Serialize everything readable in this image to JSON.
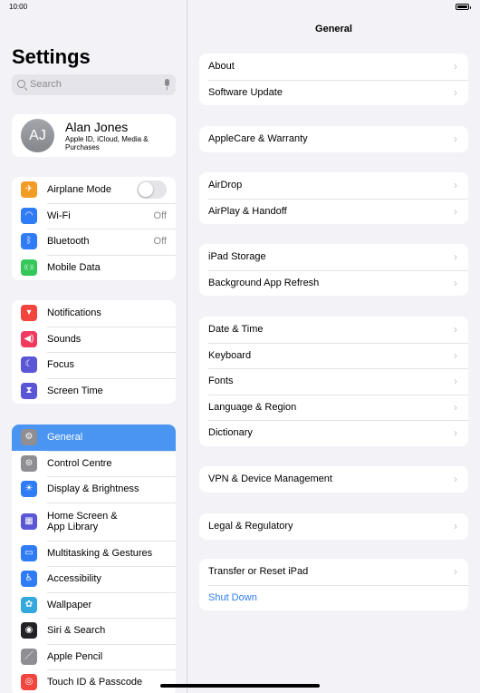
{
  "status": {
    "time": "10:00"
  },
  "sidebar": {
    "title": "Settings",
    "search_placeholder": "Search",
    "profile": {
      "initials": "AJ",
      "name": "Alan Jones",
      "subtitle": "Apple ID, iCloud, Media & Purchases"
    },
    "group1": [
      {
        "label": "Airplane Mode",
        "icon": "airplane-icon",
        "glyph": "✈",
        "color": "#f39c24",
        "control": "toggle"
      },
      {
        "label": "Wi-Fi",
        "icon": "wifi-icon",
        "glyph": "◠",
        "color": "#2f7cf6",
        "value": "Off"
      },
      {
        "label": "Bluetooth",
        "icon": "bluetooth-icon",
        "glyph": "ᛒ",
        "color": "#2f7cf6",
        "value": "Off"
      },
      {
        "label": "Mobile Data",
        "icon": "antenna-icon",
        "glyph": "((·))",
        "color": "#35c759"
      }
    ],
    "group2": [
      {
        "label": "Notifications",
        "icon": "bell-icon",
        "glyph": "▾",
        "color": "#f2453d"
      },
      {
        "label": "Sounds",
        "icon": "speaker-icon",
        "glyph": "◀)",
        "color": "#f03a5f"
      },
      {
        "label": "Focus",
        "icon": "moon-icon",
        "glyph": "☾",
        "color": "#5b56d6"
      },
      {
        "label": "Screen Time",
        "icon": "hourglass-icon",
        "glyph": "⧗",
        "color": "#5b56d6"
      }
    ],
    "group3": [
      {
        "label": "General",
        "icon": "gear-icon",
        "glyph": "⚙",
        "color": "#8e8e93",
        "selected": true
      },
      {
        "label": "Control Centre",
        "icon": "switches-icon",
        "glyph": "⊜",
        "color": "#8e8e93"
      },
      {
        "label": "Display & Brightness",
        "icon": "sun-icon",
        "glyph": "☀",
        "color": "#2f7cf6"
      },
      {
        "label": "Home Screen & App Library",
        "icon": "grid-icon",
        "glyph": "▦",
        "color": "#5b56d6",
        "tall": true
      },
      {
        "label": "Multitasking & Gestures",
        "icon": "multitask-icon",
        "glyph": "▭",
        "color": "#2f7cf6"
      },
      {
        "label": "Accessibility",
        "icon": "accessibility-icon",
        "glyph": "♿",
        "color": "#2f7cf6"
      },
      {
        "label": "Wallpaper",
        "icon": "flower-icon",
        "glyph": "✿",
        "color": "#34aadc"
      },
      {
        "label": "Siri & Search",
        "icon": "siri-icon",
        "glyph": "◉",
        "color": "#222226"
      },
      {
        "label": "Apple Pencil",
        "icon": "pencil-icon",
        "glyph": "／",
        "color": "#8e8e93"
      },
      {
        "label": "Touch ID & Passcode",
        "icon": "fingerprint-icon",
        "glyph": "◎",
        "color": "#f2453d"
      }
    ]
  },
  "main": {
    "title": "General",
    "groups": [
      [
        "About",
        "Software Update"
      ],
      [
        "AppleCare & Warranty"
      ],
      [
        "AirDrop",
        "AirPlay & Handoff"
      ],
      [
        "iPad Storage",
        "Background App Refresh"
      ],
      [
        "Date & Time",
        "Keyboard",
        "Fonts",
        "Language & Region",
        "Dictionary"
      ],
      [
        "VPN & Device Management"
      ],
      [
        "Legal & Regulatory"
      ],
      [
        "Transfer or Reset iPad",
        "Shut Down"
      ]
    ],
    "link_item": "Shut Down",
    "chevron": "›"
  }
}
